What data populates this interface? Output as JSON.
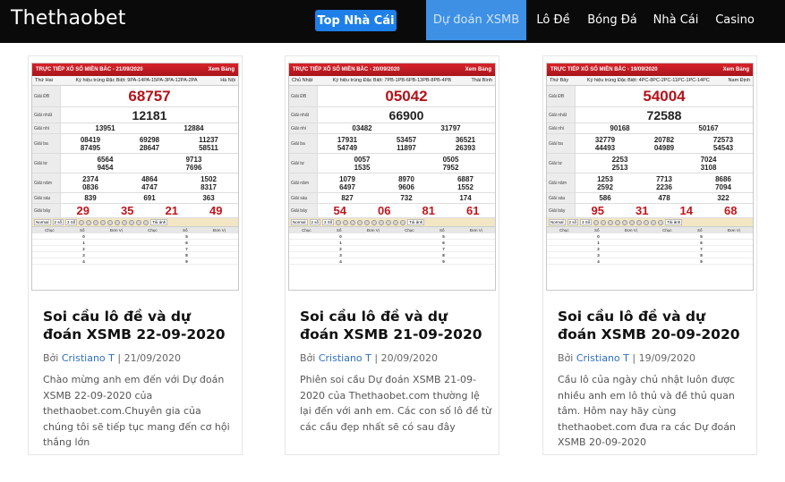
{
  "nav": {
    "logo": "Thethaobet",
    "top_button": "Top Nhà Cái",
    "items": [
      {
        "label": "Dự đoán XSMB",
        "active": true
      },
      {
        "label": "Lô Đề",
        "active": false
      },
      {
        "label": "Bóng Đá",
        "active": false
      },
      {
        "label": "Nhà Cái",
        "active": false
      },
      {
        "label": "Casino",
        "active": false
      }
    ]
  },
  "colors": {
    "navbar": "#0a0a0a",
    "accent": "#1e7fe8",
    "active_nav": "#3d90e4",
    "author_link": "#2d6fc0",
    "ticket_red": "#b3131a"
  },
  "posts": [
    {
      "title": "Soi cầu lô đề và dự đoán XSMB 22-09-2020",
      "by": "Bởi",
      "author": "Cristiano T",
      "date": "21/09/2020",
      "excerpt": "Chào mừng anh em đến với Dự đoán XSMB 22-09-2020 của thethaobet.com.Chuyên gia của chúng tôi sẽ tiếp tục mang đến cơ hội thắng lớn",
      "ticket": {
        "header": "TRỰC TIẾP XỔ SỐ MIỀN BẮC - 21/09/2020",
        "header_right": "Xem Bảng",
        "day": "Thứ Hai",
        "codes": "Ký hiệu trúng Đặc Biệt: 9PA-14PA-15PA-3PA-12PA-2PA",
        "region": "Hà Nội",
        "rows": [
          {
            "label": "Giải ĐB",
            "cls": "r-db",
            "values": [
              "68757"
            ]
          },
          {
            "label": "Giải nhất",
            "cls": "r-nhat",
            "values": [
              "12181"
            ]
          },
          {
            "label": "Giải nhì",
            "cls": "r-norm",
            "values": [
              "13951",
              "12884"
            ]
          },
          {
            "label": "Giải ba",
            "cls": "r-norm",
            "values": [
              "08419",
              "69298",
              "11237",
              "87495",
              "28647",
              "58511"
            ]
          },
          {
            "label": "Giải tư",
            "cls": "r-norm",
            "values": [
              "6564",
              "9713",
              "9454",
              "7696"
            ]
          },
          {
            "label": "Giải năm",
            "cls": "r-norm",
            "values": [
              "2374",
              "4864",
              "1502",
              "0836",
              "4747",
              "8317"
            ]
          },
          {
            "label": "Giải sáu",
            "cls": "r-norm",
            "values": [
              "839",
              "691",
              "363"
            ]
          },
          {
            "label": "Giải bảy",
            "cls": "r-bay",
            "values": [
              "29",
              "35",
              "21",
              "49"
            ]
          }
        ]
      }
    },
    {
      "title": "Soi cầu lô đề và dự đoán XSMB 21-09-2020",
      "by": "Bởi",
      "author": "Cristiano T",
      "date": "20/09/2020",
      "excerpt": "Phiên soi cầu Dự đoán XSMB 21-09-2020 của Thethaobet.com thường lệ lại đến với anh em. Các con số lô đề từ các cầu đẹp nhất sẽ có sau đây",
      "ticket": {
        "header": "TRỰC TIẾP XỔ SỐ MIỀN BẮC - 20/09/2020",
        "header_right": "Xem Bảng",
        "day": "Chủ Nhật",
        "codes": "Ký hiệu trúng Đặc Biệt: 7PB-1PB-6PB-13PB-8PB-4PB",
        "region": "Thái Bình",
        "rows": [
          {
            "label": "Giải ĐB",
            "cls": "r-db",
            "values": [
              "05042"
            ]
          },
          {
            "label": "Giải nhất",
            "cls": "r-nhat",
            "values": [
              "66900"
            ]
          },
          {
            "label": "Giải nhì",
            "cls": "r-norm",
            "values": [
              "03482",
              "31797"
            ]
          },
          {
            "label": "Giải ba",
            "cls": "r-norm",
            "values": [
              "17931",
              "53457",
              "36521",
              "54749",
              "11897",
              "26393"
            ]
          },
          {
            "label": "Giải tư",
            "cls": "r-norm",
            "values": [
              "0057",
              "0505",
              "1535",
              "7952"
            ]
          },
          {
            "label": "Giải năm",
            "cls": "r-norm",
            "values": [
              "1079",
              "8970",
              "6887",
              "6497",
              "9606",
              "1552"
            ]
          },
          {
            "label": "Giải sáu",
            "cls": "r-norm",
            "values": [
              "827",
              "732",
              "174"
            ]
          },
          {
            "label": "Giải bảy",
            "cls": "r-bay",
            "values": [
              "54",
              "06",
              "81",
              "61"
            ]
          }
        ]
      }
    },
    {
      "title": "Soi cầu lô đề và dự đoán XSMB 20-09-2020",
      "by": "Bởi",
      "author": "Cristiano T",
      "date": "19/09/2020",
      "excerpt": "Cầu lô của ngày chủ nhật luôn được nhiều anh em lô thủ và đề thủ quan tâm. Hôm nay hãy cùng thethaobet.com đưa ra các Dự đoán XSMB 20-09-2020",
      "ticket": {
        "header": "TRỰC TIẾP XỔ SỐ MIỀN BẮC - 19/09/2020",
        "header_right": "Xem Bảng",
        "day": "Thứ Bảy",
        "codes": "Ký hiệu trúng Đặc Biệt: 4PC-8PC-2PC-11PC-1PC-14PC",
        "region": "Nam Định",
        "rows": [
          {
            "label": "Giải ĐB",
            "cls": "r-db",
            "values": [
              "54004"
            ]
          },
          {
            "label": "Giải nhất",
            "cls": "r-nhat",
            "values": [
              "72588"
            ]
          },
          {
            "label": "Giải nhì",
            "cls": "r-norm",
            "values": [
              "90168",
              "50167"
            ]
          },
          {
            "label": "Giải ba",
            "cls": "r-norm",
            "values": [
              "32779",
              "20782",
              "72573",
              "44493",
              "04989",
              "54543"
            ]
          },
          {
            "label": "Giải tư",
            "cls": "r-norm",
            "values": [
              "2253",
              "7024",
              "2513",
              "3108"
            ]
          },
          {
            "label": "Giải năm",
            "cls": "r-norm",
            "values": [
              "1253",
              "7713",
              "8686",
              "2592",
              "2236",
              "7094"
            ]
          },
          {
            "label": "Giải sáu",
            "cls": "r-norm",
            "values": [
              "586",
              "478",
              "322"
            ]
          },
          {
            "label": "Giải bảy",
            "cls": "r-bay",
            "values": [
              "95",
              "31",
              "14",
              "68"
            ]
          }
        ]
      }
    }
  ],
  "ticket_common": {
    "bar_tags": [
      "Normal",
      "2 số",
      "3 Số"
    ],
    "bar_right": "Tải ảnh",
    "lodo_headers": [
      "Chục",
      "Số",
      "Đơn Vị"
    ],
    "lodo_digits": [
      "0",
      "1",
      "2",
      "3",
      "4",
      "5",
      "6",
      "7",
      "8",
      "9"
    ]
  }
}
